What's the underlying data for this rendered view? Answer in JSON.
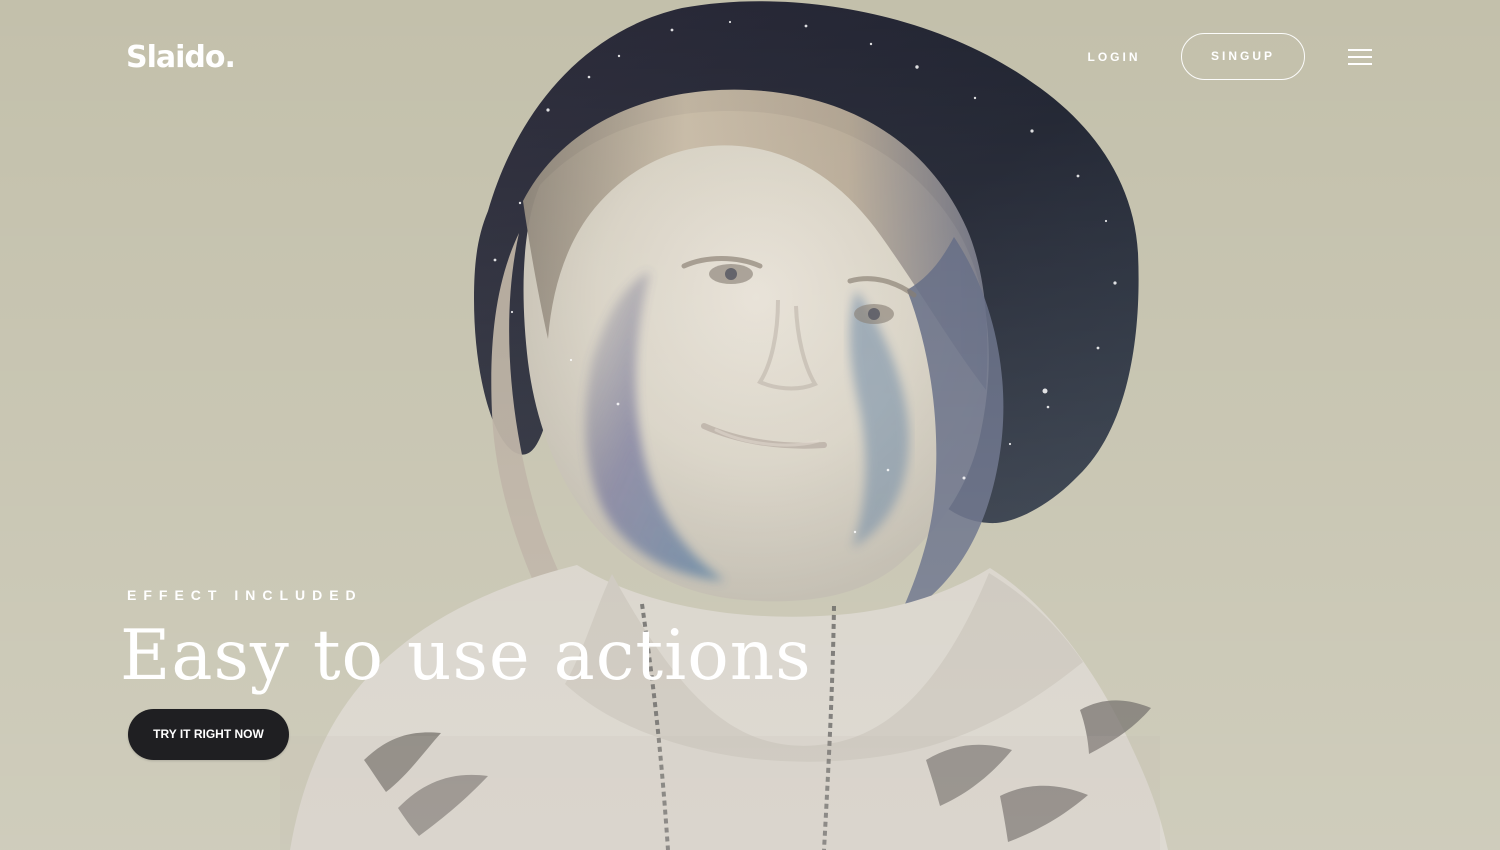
{
  "brand": {
    "name": "Slaido."
  },
  "nav": {
    "login_label": "LOGIN",
    "signup_label": "SINGUP",
    "menu_icon": "hamburger-icon"
  },
  "hero": {
    "eyebrow": "EFFECT INCLUDED",
    "headline": "Easy to use actions",
    "cta_label": "TRY IT RIGHT NOW"
  },
  "colors": {
    "background": "#c3c0ab",
    "text_primary": "#ffffff",
    "cta_background": "#1f1f22"
  }
}
